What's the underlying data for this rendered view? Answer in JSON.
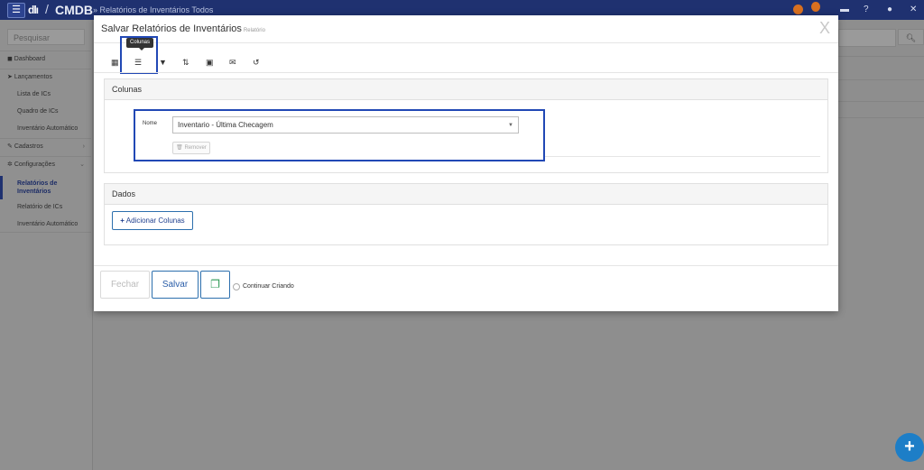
{
  "topbar": {
    "menu_icon": "☰",
    "logo": "dlı",
    "slash": "/",
    "app_name": "CMDB",
    "breadcrumb": "» Relatórios de Inventários Todos",
    "icons": [
      "avatar-icon",
      "notification-icon",
      "card-icon",
      "help-icon",
      "user-icon",
      "close-icon"
    ],
    "accent": "#1f3170"
  },
  "sidebar": {
    "search_placeholder": "Pesquisar",
    "items": [
      {
        "label": "Dashboard",
        "icon": "dashboard-icon"
      },
      {
        "label": "Lançamentos",
        "icon": "send-icon"
      },
      {
        "label": "Lista de ICs"
      },
      {
        "label": "Quadro de ICs"
      },
      {
        "label": "Inventário Automático"
      },
      {
        "label": "Cadastros",
        "icon": "edit-icon",
        "chevron": "›"
      },
      {
        "label": "Configurações",
        "icon": "gear-icon",
        "chevron": "⌄"
      },
      {
        "label": "Relatórios de Inventários"
      },
      {
        "label": "Relatório de ICs"
      },
      {
        "label": "Inventário Automático"
      }
    ]
  },
  "modal": {
    "title": "Salvar Relatórios de Inventários",
    "subtitle": "Relatório",
    "close": "X",
    "tooltip": "Colunas",
    "toolbar_icons": [
      "table-icon",
      "list-icon",
      "filter-icon",
      "sort-icon",
      "calendar-icon",
      "envelope-icon",
      "undo-icon"
    ],
    "colunas": {
      "header": "Colunas",
      "field_label": "Nome",
      "field_value": "Inventario - Última Checagem",
      "remove_label": "Remover"
    },
    "dados": {
      "header": "Dados",
      "add_label": "Adicionar Colunas"
    },
    "footer": {
      "close_label": "Fechar",
      "save_label": "Salvar",
      "continue_label": "Continuar Criando"
    }
  },
  "fab": "+"
}
